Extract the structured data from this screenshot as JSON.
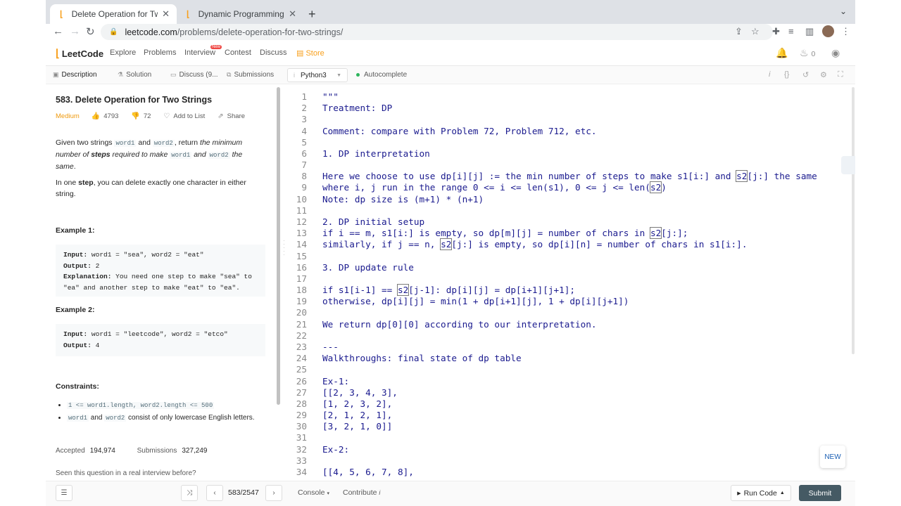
{
  "browser": {
    "tabs": [
      {
        "title": "Delete Operation for Two Strings",
        "active": true
      },
      {
        "title": "Dynamic Programming Practice",
        "active": false
      }
    ],
    "new_tab": "+",
    "url_host": "leetcode.com",
    "url_path": "/problems/delete-operation-for-two-strings/"
  },
  "nav": {
    "logo": "LeetCode",
    "links": [
      "Explore",
      "Problems",
      "Interview",
      "Contest",
      "Discuss"
    ],
    "interview_badge": "New",
    "store": "Store",
    "coins": "0"
  },
  "desc_tabs": {
    "description": "Description",
    "solution": "Solution",
    "discuss": "Discuss (9...",
    "submissions": "Submissions"
  },
  "editor_bar": {
    "language": "Python3",
    "autocomplete": "Autocomplete"
  },
  "problem": {
    "title": "583. Delete Operation for Two Strings",
    "difficulty": "Medium",
    "likes": "4793",
    "dislikes": "72",
    "add_to_list": "Add to List",
    "share": "Share",
    "p1_a": "Given two strings ",
    "p1_code1": "word1",
    "p1_b": " and ",
    "p1_code2": "word2",
    "p1_c": ", return ",
    "p1_d": "the minimum number of ",
    "p1_e": "steps",
    "p1_f": " required to make ",
    "p1_code3": "word1",
    "p1_g": " and ",
    "p1_code4": "word2",
    "p1_h": " the same",
    "p1_i": ".",
    "p2_a": "In one ",
    "p2_b": "step",
    "p2_c": ", you can delete exactly one character in either string.",
    "ex1_head": "Example 1:",
    "ex1_input_label": "Input:",
    "ex1_input": " word1 = \"sea\", word2 = \"eat\"",
    "ex1_output_label": "Output:",
    "ex1_output": " 2",
    "ex1_expl_label": "Explanation:",
    "ex1_expl_a": " You need one step to make \"sea\" to",
    "ex1_expl_b": "\"ea\" and another step to make \"eat\" to \"ea\".",
    "ex2_head": "Example 2:",
    "ex2_input_label": "Input:",
    "ex2_input": " word1 = \"leetcode\", word2 = \"etco\"",
    "ex2_output_label": "Output:",
    "ex2_output": " 4",
    "constraints_head": "Constraints:",
    "c1": "1 <= word1.length, word2.length <= 500",
    "c2_code1": "word1",
    "c2_a": " and ",
    "c2_code2": "word2",
    "c2_b": " consist of only lowercase English letters.",
    "accepted_label": "Accepted",
    "accepted": "194,974",
    "submissions_label": "Submissions",
    "submissions": "327,249",
    "seen": "Seen this question in a real interview before?"
  },
  "code_lines": [
    {
      "n": "1",
      "t": "\"\"\""
    },
    {
      "n": "2",
      "t": "Treatment: DP"
    },
    {
      "n": "3",
      "t": ""
    },
    {
      "n": "4",
      "t": "Comment: compare with Problem 72, Problem 712, etc."
    },
    {
      "n": "5",
      "t": ""
    },
    {
      "n": "6",
      "t": "1. DP interpretation"
    },
    {
      "n": "7",
      "t": ""
    },
    {
      "n": "8",
      "t": "Here we choose to use dp[i][j] := the min number of steps to make s1[i:] and s2[j:] the same"
    },
    {
      "n": "9",
      "t": "where i, j run in the range 0 <= i <= len(s1), 0 <= j <= len(s2)"
    },
    {
      "n": "10",
      "t": "Note: dp size is (m+1) * (n+1)"
    },
    {
      "n": "11",
      "t": ""
    },
    {
      "n": "12",
      "t": "2. DP initial setup"
    },
    {
      "n": "13",
      "t": "if i == m, s1[i:] is empty, so dp[m][j] = number of chars in s2[j:];"
    },
    {
      "n": "14",
      "t": "similarly, if j == n, s2[j:] is empty, so dp[i][n] = number of chars in s1[i:]."
    },
    {
      "n": "15",
      "t": ""
    },
    {
      "n": "16",
      "t": "3. DP update rule"
    },
    {
      "n": "17",
      "t": ""
    },
    {
      "n": "18",
      "t": "if s1[i-1] == s2[j-1]: dp[i][j] = dp[i+1][j+1];"
    },
    {
      "n": "19",
      "t": "otherwise, dp[i][j] = min(1 + dp[i+1][j], 1 + dp[i][j+1])"
    },
    {
      "n": "20",
      "t": ""
    },
    {
      "n": "21",
      "t": "We return dp[0][0] according to our interpretation."
    },
    {
      "n": "22",
      "t": ""
    },
    {
      "n": "23",
      "t": "---"
    },
    {
      "n": "24",
      "t": "Walkthroughs: final state of dp table"
    },
    {
      "n": "25",
      "t": ""
    },
    {
      "n": "26",
      "t": "Ex-1:"
    },
    {
      "n": "27",
      "t": "[[2, 3, 4, 3],"
    },
    {
      "n": "28",
      "t": "[1, 2, 3, 2],"
    },
    {
      "n": "29",
      "t": "[2, 1, 2, 1],"
    },
    {
      "n": "30",
      "t": "[3, 2, 1, 0]]"
    },
    {
      "n": "31",
      "t": ""
    },
    {
      "n": "32",
      "t": "Ex-2:"
    },
    {
      "n": "33",
      "t": ""
    },
    {
      "n": "34",
      "t": "[[4, 5, 6, 7, 8],"
    }
  ],
  "new_button": "NEW",
  "bottom": {
    "page": "583/2547",
    "console": "Console",
    "contribute": "Contribute",
    "run_code": "Run Code",
    "submit": "Submit"
  }
}
